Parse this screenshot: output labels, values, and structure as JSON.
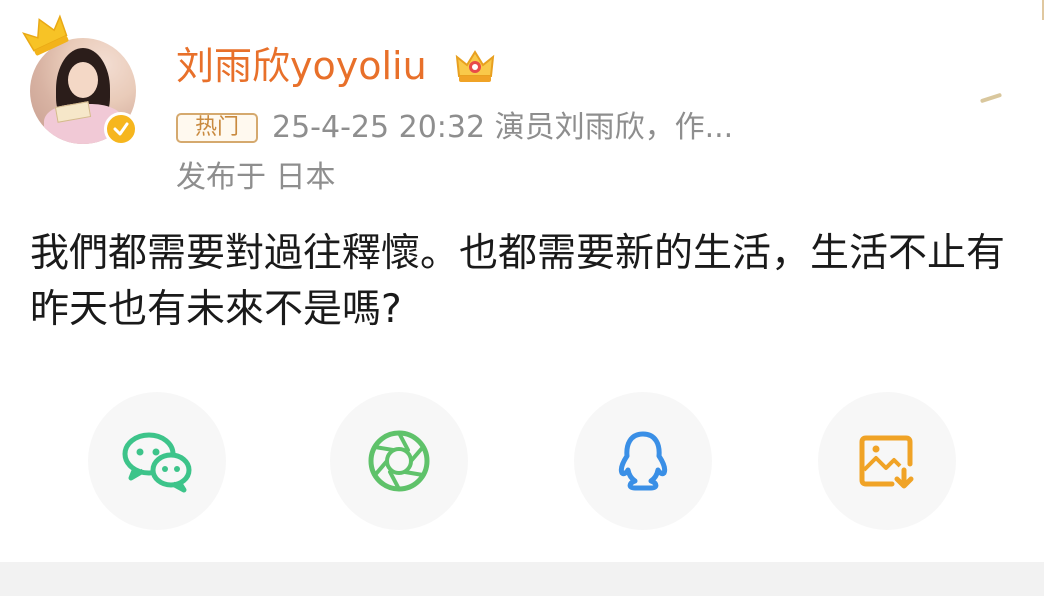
{
  "post": {
    "username": "刘雨欣yoyoliu",
    "hot_badge": "热门",
    "meta": "25-4-25 20:32  演员刘雨欣，作...",
    "location": "发布于 日本",
    "text": "我們都需要對過往釋懷。也都需要新的生活，生活不止有昨天也有未來不是嗎?"
  },
  "colors": {
    "username": "#e8702a",
    "verified_badge": "#f6b61e",
    "wechat": "#3dc48a",
    "moments": "#5fc26a",
    "qq": "#3a8fe6",
    "save_image": "#f0a326",
    "bottom_strip": "#f2f2f2"
  },
  "share_buttons": [
    {
      "icon": "wechat-icon"
    },
    {
      "icon": "moments-icon"
    },
    {
      "icon": "qq-icon"
    },
    {
      "icon": "save-image-icon"
    }
  ]
}
